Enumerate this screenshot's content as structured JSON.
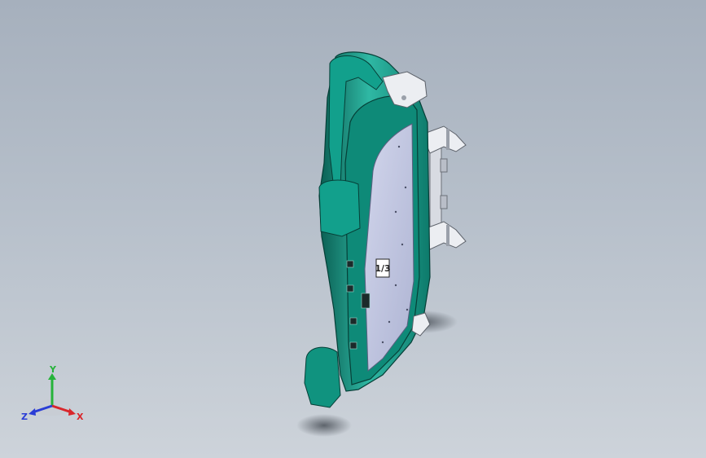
{
  "viewport": {
    "background_top": "#a6b0bd",
    "background_bottom": "#cdd3da"
  },
  "model": {
    "body_color": "#0f8f7d",
    "body_dark": "#0a5e52",
    "body_light": "#2fb8a4",
    "panel_color": "#c3c8e3",
    "clamp_color": "#e8eaee",
    "panel_label": "1/3"
  },
  "triad": {
    "x_label": "X",
    "y_label": "Y",
    "z_label": "Z",
    "x_color": "#d9262b",
    "y_color": "#26b33a",
    "z_color": "#2a3dd6"
  }
}
